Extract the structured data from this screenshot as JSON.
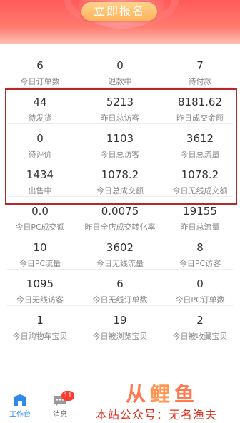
{
  "banner": {
    "button_label": "立即报名"
  },
  "stats": [
    [
      {
        "value": "6",
        "label": "今日订单数"
      },
      {
        "value": "0",
        "label": "退款中"
      },
      {
        "value": "7",
        "label": "待付款"
      }
    ],
    [
      {
        "value": "44",
        "label": "待发货"
      },
      {
        "value": "5213",
        "label": "昨日总访客"
      },
      {
        "value": "8181.62",
        "label": "昨日成交金额"
      }
    ],
    [
      {
        "value": "0",
        "label": "待评价"
      },
      {
        "value": "1103",
        "label": "今日总访客"
      },
      {
        "value": "3612",
        "label": "今日总流量"
      }
    ],
    [
      {
        "value": "1434",
        "label": "出售中"
      },
      {
        "value": "1078.2",
        "label": "今日总成交额"
      },
      {
        "value": "1078.2",
        "label": "今日无线成交额"
      }
    ],
    [
      {
        "value": "0.0",
        "label": "今日PC成交额"
      },
      {
        "value": "0.0075",
        "label": "昨日全店成交转化率"
      },
      {
        "value": "19155",
        "label": "昨日总流量"
      }
    ],
    [
      {
        "value": "10",
        "label": "今日PC流量"
      },
      {
        "value": "3602",
        "label": "今日无线流量"
      },
      {
        "value": "8",
        "label": "今日PC访客"
      }
    ],
    [
      {
        "value": "1095",
        "label": "今日无线访客"
      },
      {
        "value": "6",
        "label": "今日无线订单数"
      },
      {
        "value": "0",
        "label": "今日PC订单数"
      }
    ],
    [
      {
        "value": "1",
        "label": "今日购物车宝贝"
      },
      {
        "value": "19",
        "label": "今日被浏览宝贝"
      },
      {
        "value": "2",
        "label": "今日被收藏宝贝"
      }
    ]
  ],
  "tabbar": {
    "items": [
      {
        "label": "工作台",
        "icon": "workbench-icon"
      },
      {
        "label": "消息",
        "icon": "message-icon",
        "badge": "11"
      }
    ]
  },
  "colors": {
    "accent": "#2e8ae6",
    "highlight_border": "#b2282c",
    "banner": "#ff5a5a"
  },
  "watermark": {
    "text": "本站公众号：无名渔夫"
  }
}
